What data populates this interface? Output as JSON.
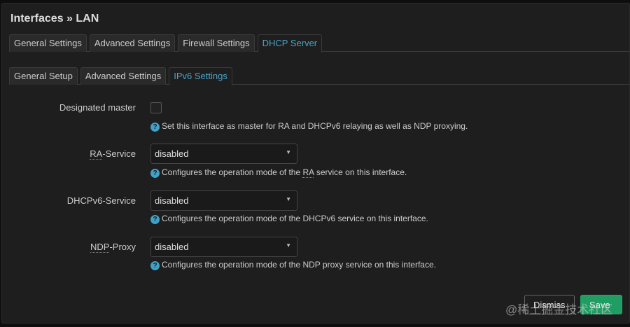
{
  "title": "Interfaces » LAN",
  "tabs": [
    "General Settings",
    "Advanced Settings",
    "Firewall Settings",
    "DHCP Server"
  ],
  "subtabs": [
    "General Setup",
    "Advanced Settings",
    "IPv6 Settings"
  ],
  "fields": {
    "designated_master": {
      "label": "Designated master",
      "checked": false,
      "help": "Set this interface as master for RA and DHCPv6 relaying as well as NDP proxying."
    },
    "ra": {
      "label_abbr": "RA",
      "label_rest": "-Service",
      "value": "disabled",
      "help_pre": "Configures the operation mode of the ",
      "help_abbr": "RA",
      "help_post": " service on this interface."
    },
    "dhcpv6": {
      "label": "DHCPv6-Service",
      "value": "disabled",
      "help": "Configures the operation mode of the DHCPv6 service on this interface."
    },
    "ndp": {
      "label_abbr": "NDP",
      "label_rest": "-Proxy",
      "value": "disabled",
      "help": "Configures the operation mode of the NDP proxy service on this interface."
    }
  },
  "buttons": {
    "dismiss": "Dismiss",
    "save": "Save"
  },
  "watermark": "@稀土掘金技术社区",
  "colors": {
    "accent": "#4aa3c8",
    "save": "#1f9d63"
  }
}
